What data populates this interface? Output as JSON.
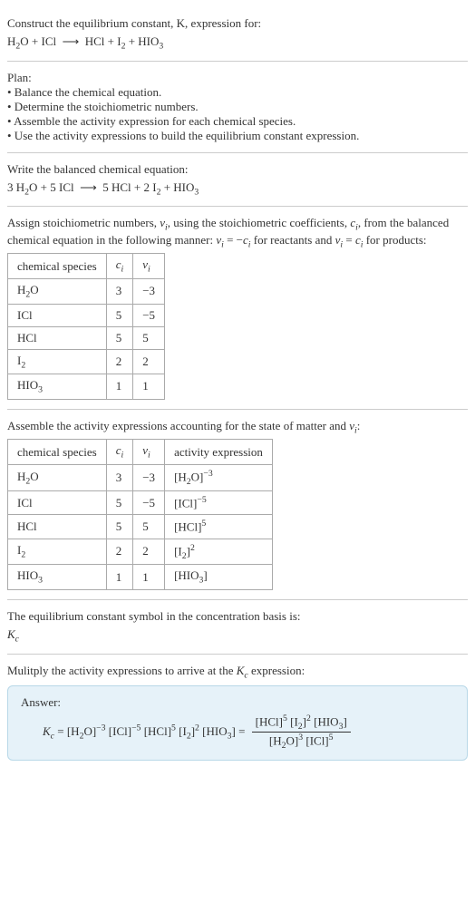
{
  "intro": {
    "line1": "Construct the equilibrium constant, K, expression for:",
    "reaction_html": "H<sub>2</sub>O + ICl&nbsp; ⟶ &nbsp;HCl + I<sub>2</sub> + HIO<sub>3</sub>"
  },
  "plan": {
    "title": "Plan:",
    "items": [
      "• Balance the chemical equation.",
      "• Determine the stoichiometric numbers.",
      "• Assemble the activity expression for each chemical species.",
      "• Use the activity expressions to build the equilibrium constant expression."
    ]
  },
  "balanced": {
    "title": "Write the balanced chemical equation:",
    "eq_html": "3 H<sub>2</sub>O + 5 ICl&nbsp; ⟶ &nbsp;5 HCl + 2 I<sub>2</sub> + HIO<sub>3</sub>"
  },
  "assign": {
    "text_html": "Assign stoichiometric numbers, <span class=\"italic\">ν<sub>i</sub></span>, using the stoichiometric coefficients, <span class=\"italic\">c<sub>i</sub></span>, from the balanced chemical equation in the following manner: <span class=\"italic\">ν<sub>i</sub></span> = −<span class=\"italic\">c<sub>i</sub></span> for reactants and <span class=\"italic\">ν<sub>i</sub></span> = <span class=\"italic\">c<sub>i</sub></span> for products:",
    "headers": [
      "chemical species",
      "c_i",
      "ν_i"
    ],
    "rows": [
      {
        "species_html": "H<sub>2</sub>O",
        "c": "3",
        "v": "−3"
      },
      {
        "species_html": "ICl",
        "c": "5",
        "v": "−5"
      },
      {
        "species_html": "HCl",
        "c": "5",
        "v": "5"
      },
      {
        "species_html": "I<sub>2</sub>",
        "c": "2",
        "v": "2"
      },
      {
        "species_html": "HIO<sub>3</sub>",
        "c": "1",
        "v": "1"
      }
    ]
  },
  "activity": {
    "title_html": "Assemble the activity expressions accounting for the state of matter and <span class=\"italic\">ν<sub>i</sub></span>:",
    "headers": [
      "chemical species",
      "c_i",
      "ν_i",
      "activity expression"
    ],
    "rows": [
      {
        "species_html": "H<sub>2</sub>O",
        "c": "3",
        "v": "−3",
        "act_html": "[H<sub>2</sub>O]<sup>−3</sup>"
      },
      {
        "species_html": "ICl",
        "c": "5",
        "v": "−5",
        "act_html": "[ICl]<sup>−5</sup>"
      },
      {
        "species_html": "HCl",
        "c": "5",
        "v": "5",
        "act_html": "[HCl]<sup>5</sup>"
      },
      {
        "species_html": "I<sub>2</sub>",
        "c": "2",
        "v": "2",
        "act_html": "[I<sub>2</sub>]<sup>2</sup>"
      },
      {
        "species_html": "HIO<sub>3</sub>",
        "c": "1",
        "v": "1",
        "act_html": "[HIO<sub>3</sub>]"
      }
    ]
  },
  "kc_symbol": {
    "title": "The equilibrium constant symbol in the concentration basis is:",
    "symbol_html": "<span class=\"italic\">K<sub>c</sub></span>"
  },
  "multiply": {
    "title_html": "Mulitply the activity expressions to arrive at the <span class=\"italic\">K<sub>c</sub></span> expression:"
  },
  "answer": {
    "label": "Answer:",
    "lhs_html": "<span class=\"italic\">K<sub>c</sub></span> = [H<sub>2</sub>O]<sup>−3</sup> [ICl]<sup>−5</sup> [HCl]<sup>5</sup> [I<sub>2</sub>]<sup>2</sup> [HIO<sub>3</sub>] = ",
    "frac_num_html": "[HCl]<sup>5</sup> [I<sub>2</sub>]<sup>2</sup> [HIO<sub>3</sub>]",
    "frac_den_html": "[H<sub>2</sub>O]<sup>3</sup> [ICl]<sup>5</sup>"
  }
}
